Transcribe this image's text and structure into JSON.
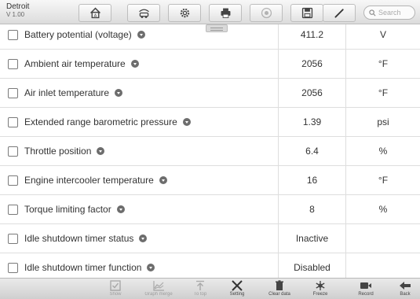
{
  "header": {
    "app_name": "Detroit",
    "version": "V 1.00",
    "search_placeholder": "Search"
  },
  "toolbar": [
    {
      "name": "home-icon",
      "enabled": true
    },
    {
      "name": "vehicle-swap-icon",
      "enabled": true
    },
    {
      "name": "settings-icon",
      "enabled": true
    },
    {
      "name": "print-icon",
      "enabled": true
    },
    {
      "name": "help-icon",
      "enabled": false
    },
    {
      "name": "save-icon",
      "enabled": true
    },
    {
      "name": "pen-icon",
      "enabled": true
    }
  ],
  "table": {
    "rows": [
      {
        "label": "Battery potential (voltage)",
        "value": "411.2",
        "unit": "V"
      },
      {
        "label": "Ambient air temperature",
        "value": "2056",
        "unit": "°F"
      },
      {
        "label": "Air inlet temperature",
        "value": "2056",
        "unit": "°F"
      },
      {
        "label": "Extended range barometric pressure",
        "value": "1.39",
        "unit": "psi"
      },
      {
        "label": "Throttle position",
        "value": "6.4",
        "unit": "%"
      },
      {
        "label": "Engine intercooler temperature",
        "value": "16",
        "unit": "°F"
      },
      {
        "label": "Torque limiting factor",
        "value": "8",
        "unit": "%"
      },
      {
        "label": "Idle shutdown timer status",
        "value": "Inactive",
        "unit": ""
      },
      {
        "label": "Idle shutdown timer function",
        "value": "Disabled",
        "unit": ""
      }
    ]
  },
  "bottom_bar": {
    "show": "Show",
    "graph_merge": "Graph merge",
    "to_top": "To top",
    "setting": "Setting",
    "clear_data": "Clear data",
    "freeze": "Freeze",
    "record": "Record",
    "back": "Back"
  }
}
